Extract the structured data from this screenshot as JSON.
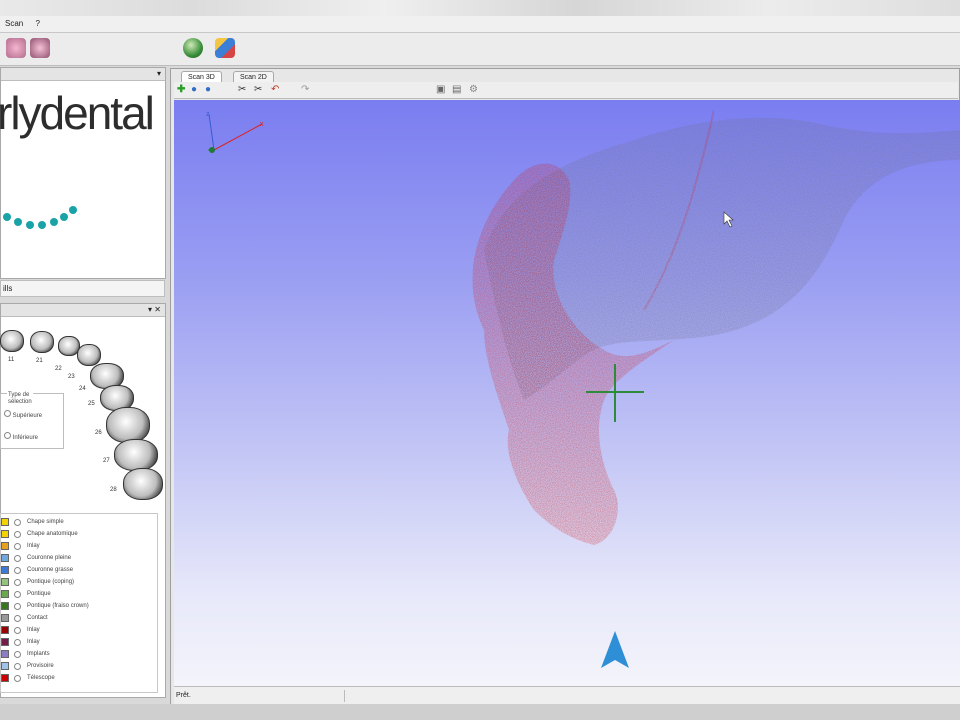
{
  "menu": {
    "items": [
      "Scan",
      "?"
    ]
  },
  "left_panel": {
    "logo_text": "rlydental",
    "partial_label": "ills",
    "arch_type": {
      "title_line1": "Type de",
      "title_line2": "sélection",
      "option_sup": "Supérieure",
      "option_inf": "Inférieure"
    },
    "tooth_numbers": [
      "11",
      "21",
      "22",
      "23",
      "24",
      "25",
      "26",
      "27",
      "28"
    ],
    "legend": [
      {
        "label": "Chape simple",
        "color": "#f4d400"
      },
      {
        "label": "Chape anatomique",
        "color": "#f4d400"
      },
      {
        "label": "Inlay",
        "color": "#e8a020"
      },
      {
        "label": "Couronne pleine",
        "color": "#6fa8dc"
      },
      {
        "label": "Couronne grasse",
        "color": "#3c78d8"
      },
      {
        "label": "Pontique (coping)",
        "color": "#93c47d"
      },
      {
        "label": "Pontique",
        "color": "#6aa84f"
      },
      {
        "label": "Pontique (fraiso crown)",
        "color": "#38761d"
      },
      {
        "label": "Contact",
        "color": "#999999"
      },
      {
        "label": "Inlay",
        "color": "#990000"
      },
      {
        "label": "Inlay",
        "color": "#741b47"
      },
      {
        "label": "Implants",
        "color": "#8e7cc3"
      },
      {
        "label": "Provisoire",
        "color": "#9fc5e8"
      },
      {
        "label": "Télescope",
        "color": "#cc0000"
      }
    ]
  },
  "view": {
    "tabs": [
      "Scan 3D",
      "Scan 2D"
    ],
    "status_text": "Prêt."
  },
  "colors": {
    "logo_dots": "#1aa3a7",
    "points_red": "#d32020",
    "points_gray": "#6b6b84",
    "cursor_green": "#2e8b3a",
    "arrow_blue": "#2f8fd6",
    "bg_top": "#7a7df0",
    "bg_bottom": "#f4f4fb"
  },
  "icons": {
    "toolbar": [
      "jaw-icon",
      "teeth-icon",
      "globe-icon",
      "cube-icon"
    ],
    "view_toolbar": [
      "add-icon",
      "zoom-in-icon",
      "zoom-out-icon",
      "cut-icon",
      "cut-icon",
      "undo-icon",
      "redo-icon",
      "save-icon",
      "print-icon",
      "settings-icon"
    ]
  }
}
